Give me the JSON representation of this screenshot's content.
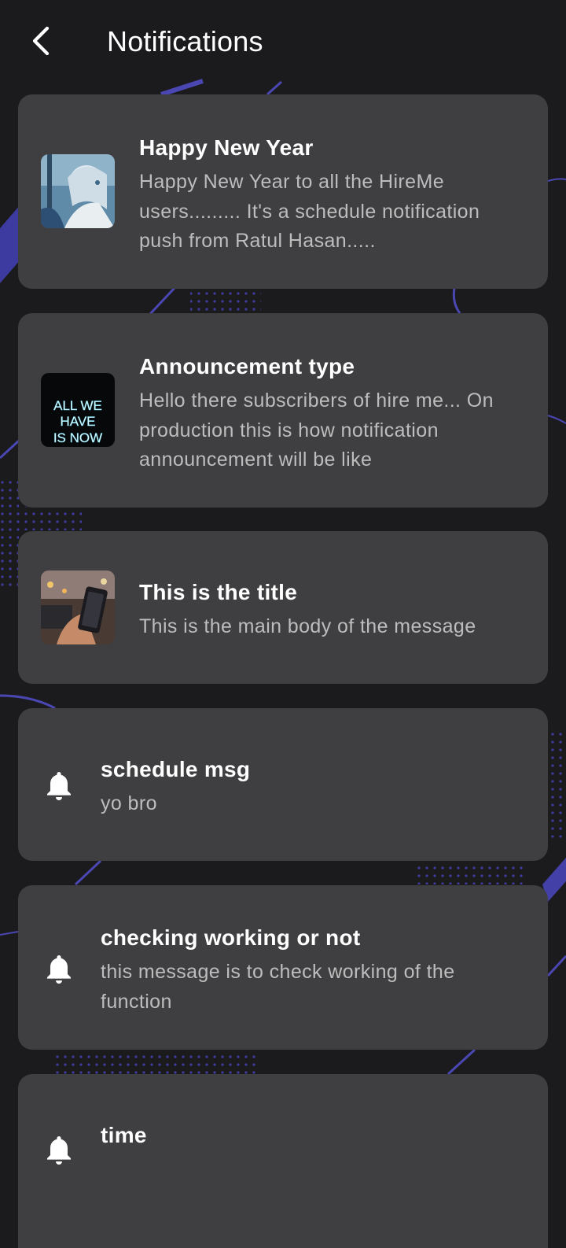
{
  "header": {
    "title": "Notifications",
    "back_icon": "chevron-left-icon"
  },
  "notifications": [
    {
      "title": "Happy New Year",
      "body": "Happy New Year to all the HireMe users......... It's a schedule notification push from Ratul Hasan.....",
      "media": "image",
      "image_desc": "anime-character-thumbnail"
    },
    {
      "title": "Announcement type",
      "body": "Hello there subscribers of hire me... On production this is how notification announcement will be like",
      "media": "image",
      "image_text": [
        "ALL WE",
        "HAVE",
        "IS NOW"
      ]
    },
    {
      "title": "This is the title",
      "body": "This is the main body of the message",
      "media": "image",
      "image_desc": "phone-in-hand-thumbnail"
    },
    {
      "title": "schedule msg",
      "body": "yo bro",
      "media": "icon",
      "icon": "bell-icon"
    },
    {
      "title": "checking working or not",
      "body": "this message is to check working of the function",
      "media": "icon",
      "icon": "bell-icon"
    },
    {
      "title": "time",
      "body": "",
      "media": "icon",
      "icon": "bell-icon"
    }
  ],
  "colors": {
    "background": "#1b1b1d",
    "card": "#3f3f41",
    "accent": "#4a47b3",
    "title": "#ffffff",
    "body": "#bdbdbd"
  }
}
